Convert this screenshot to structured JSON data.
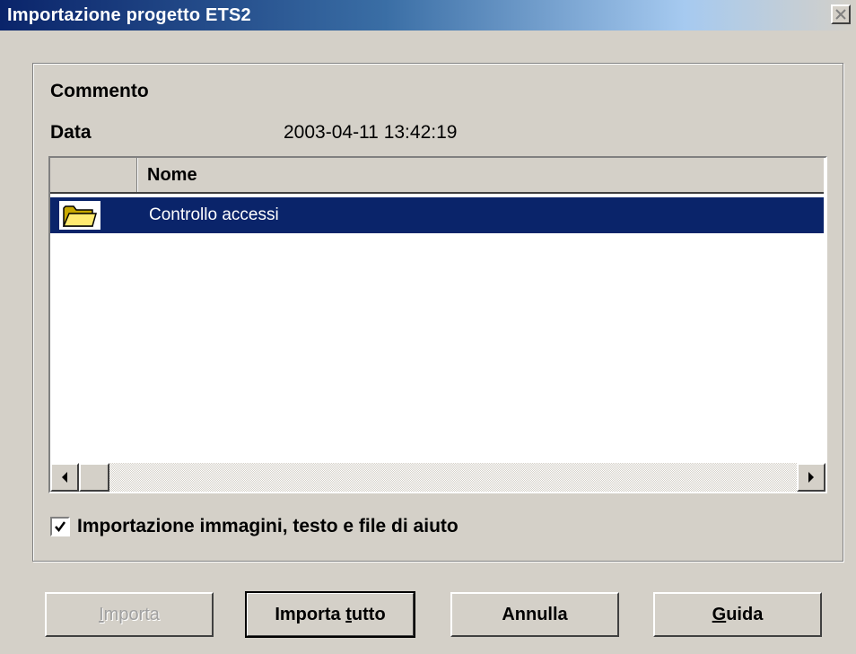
{
  "window": {
    "title": "Importazione progetto ETS2",
    "close_icon": "close-icon"
  },
  "info": {
    "comment_label": "Commento",
    "date_label": "Data",
    "date_value": "2003-04-11 13:42:19"
  },
  "list": {
    "column_header": "Nome",
    "rows": [
      {
        "icon": "folder-open-icon",
        "name": "Controllo accessi",
        "selected": true
      }
    ]
  },
  "options": {
    "include_images_label": "Importazione immagini, testo e file di aiuto",
    "include_images_checked": true
  },
  "buttons": {
    "import": {
      "pre": "",
      "key": "I",
      "post": "mporta",
      "enabled": false
    },
    "import_all": {
      "pre": "Importa ",
      "key": "t",
      "post": "utto",
      "default": true
    },
    "cancel": {
      "label": "Annulla"
    },
    "help": {
      "pre": "",
      "key": "G",
      "post": "uida"
    }
  },
  "colors": {
    "selection": "#0a246a",
    "dialog_face": "#d4d0c8"
  }
}
